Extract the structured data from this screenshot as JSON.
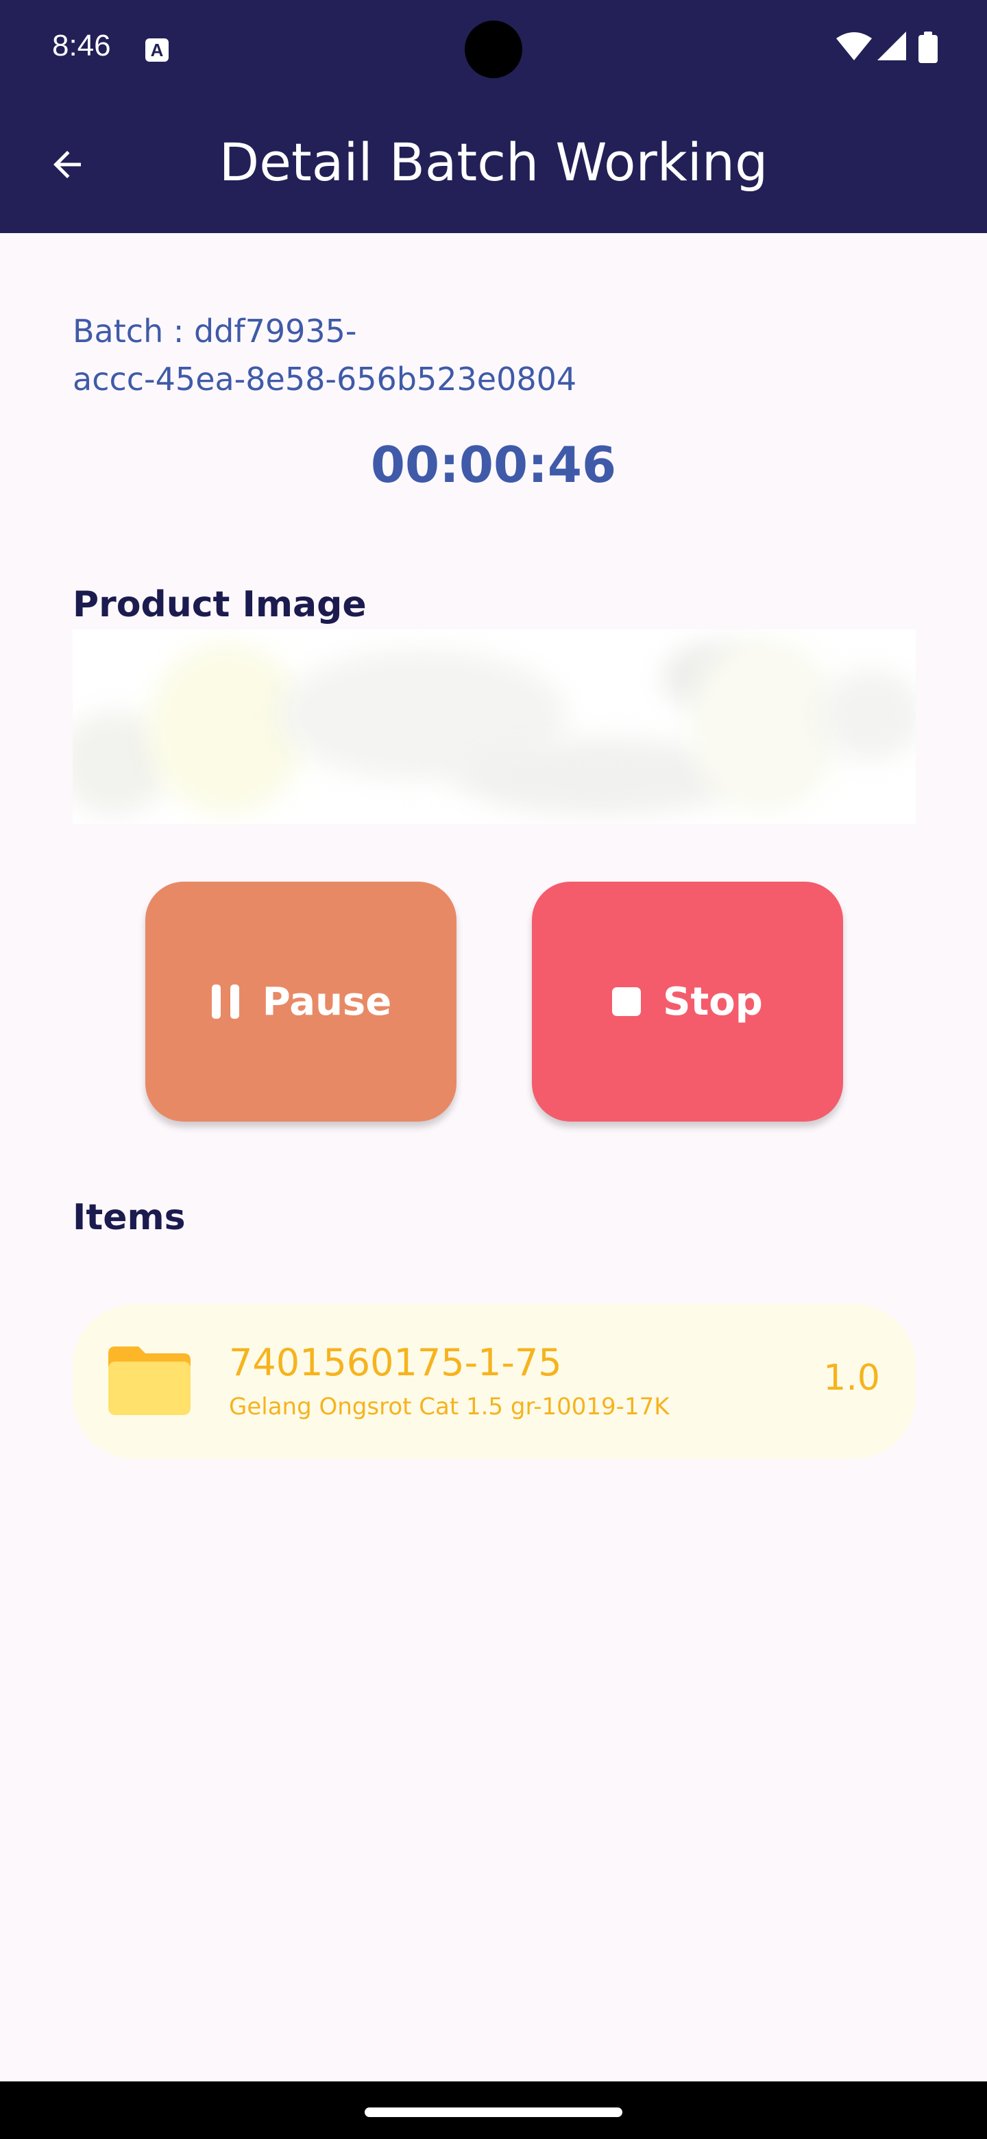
{
  "status_bar": {
    "time": "8:46",
    "notification_icon": "a-icon",
    "icons": [
      "wifi-icon",
      "signal-icon",
      "battery-icon"
    ]
  },
  "app_bar": {
    "title": "Detail Batch Working",
    "back_icon": "arrow-left-icon"
  },
  "batch": {
    "line1": "Batch : ddf79935-",
    "line2": "accc-45ea-8e58-656b523e0804"
  },
  "timer": "00:00:46",
  "product_image": {
    "label": "Product Image"
  },
  "actions": {
    "pause_label": "Pause",
    "stop_label": "Stop"
  },
  "items_label": "Items",
  "items": [
    {
      "code": "7401560175-1-75",
      "name": "Gelang Ongsrot Cat 1.5 gr-10019-17K",
      "qty": "1.0",
      "icon": "folder-icon"
    }
  ],
  "colors": {
    "primary": "#222056",
    "accent_text": "#3f5aa8",
    "pause": "#e88966",
    "stop": "#f45c6c",
    "item_text": "#f6b31d",
    "item_bg": "#fefbe9"
  }
}
